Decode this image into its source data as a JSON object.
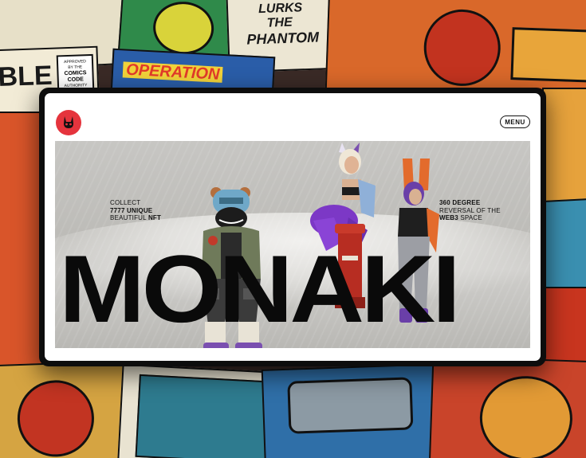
{
  "background": {
    "comic_texts": [
      "LURKS",
      "THE",
      "PHANTOM",
      "OPERATION",
      "BLE",
      "APPROVED",
      "BY THE",
      "COMICS",
      "CODE",
      "AUTHORITY"
    ]
  },
  "header": {
    "logo_icon": "rabbit-logo-icon",
    "menu_label": "MENU"
  },
  "hero": {
    "left_line1": "COLLECT",
    "left_line2_bold": "7777 UNIQUE",
    "left_line3": "BEAUTIFUL",
    "left_line3_bold": "NFT",
    "right_line1_bold": "360 DEGREE",
    "right_line2": "REVERSAL OF THE",
    "right_line3_bold": "WEB3",
    "right_line3": "SPACE",
    "title": "MONAKI"
  },
  "colors": {
    "accent": "#e5343d",
    "frame": "#0d0d0d",
    "title": "#0a0a0a"
  }
}
